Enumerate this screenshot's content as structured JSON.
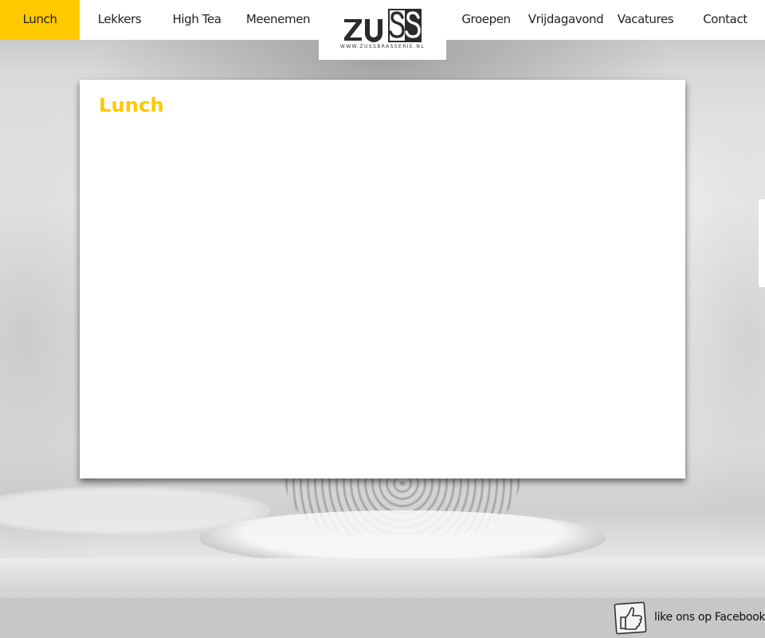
{
  "nav": {
    "left_items": [
      {
        "label": "Lunch",
        "active": true
      },
      {
        "label": "Lekkers",
        "active": false
      },
      {
        "label": "High Tea",
        "active": false
      },
      {
        "label": "Meenemen",
        "active": false
      }
    ],
    "right_items": [
      {
        "label": "Groepen",
        "active": false
      },
      {
        "label": "Vrijdagavond",
        "active": false
      },
      {
        "label": "Vacatures",
        "active": false
      },
      {
        "label": "Contact",
        "active": false
      }
    ]
  },
  "logo": {
    "wordmark": "ZUSS",
    "url_text": "WWW.ZUSSBRASSERIE.NL",
    "icon": "zuss-logo"
  },
  "content": {
    "title": "Lunch"
  },
  "footer": {
    "facebook_label": "like ons op Facebook",
    "facebook_icon": "thumbs-up-icon"
  },
  "colors": {
    "accent": "#ffc900",
    "header_bg": "#ffffff",
    "footer_bg": "#c7c7c7",
    "text": "#222222"
  }
}
